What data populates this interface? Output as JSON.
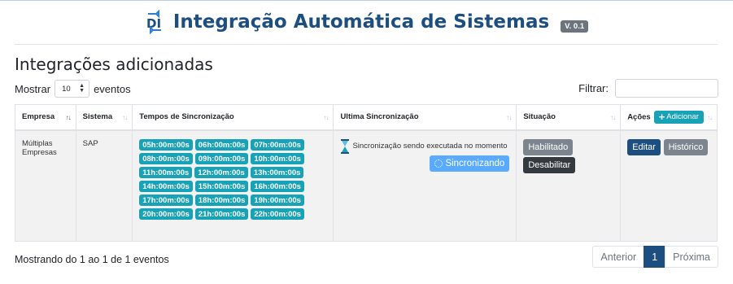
{
  "header": {
    "title": "Integração Automática de Sistemas",
    "version": "V. 0.1"
  },
  "section": {
    "title": "Integrações adicionadas"
  },
  "length_control": {
    "prefix": "Mostrar",
    "value": "10",
    "suffix": "eventos"
  },
  "filter": {
    "label": "Filtrar:",
    "value": ""
  },
  "table": {
    "columns": {
      "empresa": "Empresa",
      "sistema": "Sistema",
      "tempos": "Tempos de Sincronização",
      "ultima": "Ultima Sincronização",
      "situacao": "Situação",
      "acoes": "Ações"
    },
    "add_button": "Adicionar",
    "rows": [
      {
        "empresa": "Múltiplas Empresas",
        "sistema": "SAP",
        "times": [
          "05h:00m:00s",
          "06h:00m:00s",
          "07h:00m:00s",
          "08h:00m:00s",
          "09h:00m:00s",
          "10h:00m:00s",
          "11h:00m:00s",
          "12h:00m:00s",
          "13h:00m:00s",
          "14h:00m:00s",
          "15h:00m:00s",
          "16h:00m:00s",
          "17h:00m:00s",
          "18h:00m:00s",
          "19h:00m:00s",
          "20h:00m:00s",
          "21h:00m:00s",
          "22h:00m:00s"
        ],
        "sync_status": "Sincronização sendo executada no momento",
        "sync_button": "Sincronizando",
        "status_label": "Habilitado",
        "toggle_label": "Desabilitar",
        "edit_label": "Editar",
        "history_label": "Histórico"
      }
    ]
  },
  "footer": {
    "info": "Mostrando do 1 ao 1 de 1 eventos",
    "prev": "Anterior",
    "current_page": "1",
    "next": "Próxima"
  },
  "colors": {
    "brand": "#1c4e80",
    "time_badge": "#17a2b8",
    "sync_button": "#5aabff",
    "badge_gray": "#6c757d",
    "dark": "#343a40"
  }
}
